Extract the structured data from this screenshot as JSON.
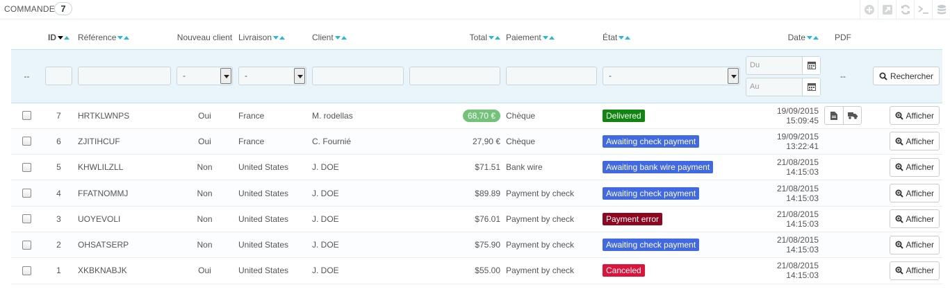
{
  "panel": {
    "title": "COMMANDES",
    "count": "7"
  },
  "toolbar": [
    {
      "icon": "add-icon"
    },
    {
      "icon": "export-icon"
    },
    {
      "icon": "refresh-icon"
    },
    {
      "icon": "terminal-icon"
    },
    {
      "icon": "database-icon"
    }
  ],
  "columns": {
    "id": "ID",
    "reference": "Référence",
    "new_client": "Nouveau client",
    "delivery": "Livraison",
    "client": "Client",
    "total": "Total",
    "payment": "Paiement",
    "state": "État",
    "date": "Date",
    "pdf": "PDF"
  },
  "filters": {
    "bulk": "--",
    "new_client_select": "-",
    "delivery_select": "-",
    "state_select": "-",
    "date_from_placeholder": "Du",
    "date_to_placeholder": "Au",
    "pdf": "--",
    "search_label": "Rechercher"
  },
  "view_label": "Afficher",
  "colors": {
    "delivered": "#108510",
    "awaiting": "#4169e1",
    "error": "#8f0621",
    "canceled": "#dc143c",
    "price_pill": "#72c279"
  },
  "orders": [
    {
      "id": "7",
      "reference": "HRTKLWNPS",
      "new_client": "Oui",
      "delivery": "France",
      "client": "M. rodellas",
      "total": "68,70 €",
      "highlight_total": true,
      "payment": "Chèque",
      "state": "Delivered",
      "state_color": "#108510",
      "date": "19/09/2015",
      "time": "15:09:45",
      "has_pdf": true
    },
    {
      "id": "6",
      "reference": "ZJITIHCUF",
      "new_client": "Oui",
      "delivery": "France",
      "client": "C. Fournié",
      "total": "27,90 €",
      "highlight_total": false,
      "payment": "Chèque",
      "state": "Awaiting check payment",
      "state_color": "#4169e1",
      "date": "19/09/2015",
      "time": "13:22:41",
      "has_pdf": false
    },
    {
      "id": "5",
      "reference": "KHWLILZLL",
      "new_client": "Non",
      "delivery": "United States",
      "client": "J. DOE",
      "total": "$71.51",
      "highlight_total": false,
      "payment": "Bank wire",
      "state": "Awaiting bank wire payment",
      "state_color": "#4169e1",
      "date": "21/08/2015",
      "time": "14:15:03",
      "has_pdf": false
    },
    {
      "id": "4",
      "reference": "FFATNOMMJ",
      "new_client": "Non",
      "delivery": "United States",
      "client": "J. DOE",
      "total": "$89.89",
      "highlight_total": false,
      "payment": "Payment by check",
      "state": "Awaiting check payment",
      "state_color": "#4169e1",
      "date": "21/08/2015",
      "time": "14:15:03",
      "has_pdf": false
    },
    {
      "id": "3",
      "reference": "UOYEVOLI",
      "new_client": "Non",
      "delivery": "United States",
      "client": "J. DOE",
      "total": "$76.01",
      "highlight_total": false,
      "payment": "Payment by check",
      "state": "Payment error",
      "state_color": "#8f0621",
      "date": "21/08/2015",
      "time": "14:15:03",
      "has_pdf": false
    },
    {
      "id": "2",
      "reference": "OHSATSERP",
      "new_client": "Non",
      "delivery": "United States",
      "client": "J. DOE",
      "total": "$75.90",
      "highlight_total": false,
      "payment": "Payment by check",
      "state": "Awaiting check payment",
      "state_color": "#4169e1",
      "date": "21/08/2015",
      "time": "14:15:03",
      "has_pdf": false
    },
    {
      "id": "1",
      "reference": "XKBKNABJK",
      "new_client": "Oui",
      "delivery": "United States",
      "client": "J. DOE",
      "total": "$55.00",
      "highlight_total": false,
      "payment": "Payment by check",
      "state": "Canceled",
      "state_color": "#dc143c",
      "date": "21/08/2015",
      "time": "14:15:03",
      "has_pdf": false
    }
  ]
}
